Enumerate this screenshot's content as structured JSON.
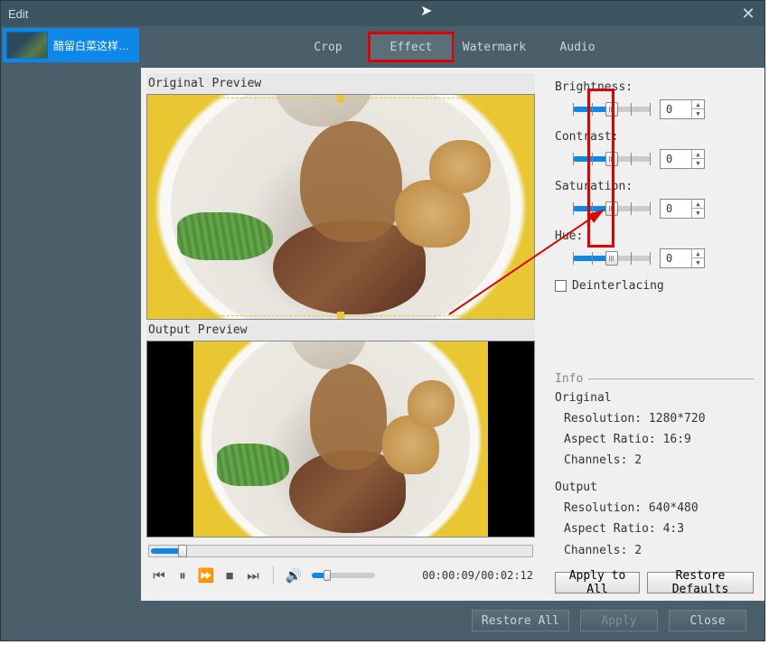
{
  "window": {
    "title": "Edit"
  },
  "sidebar": {
    "items": [
      {
        "label": "醋留白菜这样…"
      }
    ]
  },
  "tabs": {
    "items": [
      {
        "label": "Crop",
        "active": false
      },
      {
        "label": "Effect",
        "active": true
      },
      {
        "label": "Watermark",
        "active": false
      },
      {
        "label": "Audio",
        "active": false
      }
    ]
  },
  "previews": {
    "original_label": "Original Preview",
    "output_label": "Output Preview"
  },
  "playback": {
    "time": "00:00:09/00:02:12"
  },
  "settings": {
    "brightness": {
      "label": "Brightness:",
      "value": "0"
    },
    "contrast": {
      "label": "Contrast:",
      "value": "0"
    },
    "saturation": {
      "label": "Saturation:",
      "value": "0"
    },
    "hue": {
      "label": "Hue:",
      "value": "0"
    },
    "deinterlacing": {
      "label": "Deinterlacing",
      "checked": false
    }
  },
  "info": {
    "header": "Info",
    "original": {
      "heading": "Original",
      "resolution_label": "Resolution:",
      "resolution_value": "1280*720",
      "aspect_label": "Aspect Ratio:",
      "aspect_value": "16:9",
      "channels_label": "Channels:",
      "channels_value": "2"
    },
    "output": {
      "heading": "Output",
      "resolution_label": "Resolution:",
      "resolution_value": "640*480",
      "aspect_label": "Aspect Ratio:",
      "aspect_value": "4:3",
      "channels_label": "Channels:",
      "channels_value": "2"
    }
  },
  "buttons": {
    "apply_all": "Apply to All",
    "restore_defaults": "Restore Defaults",
    "restore_all": "Restore All",
    "apply": "Apply",
    "close": "Close"
  }
}
